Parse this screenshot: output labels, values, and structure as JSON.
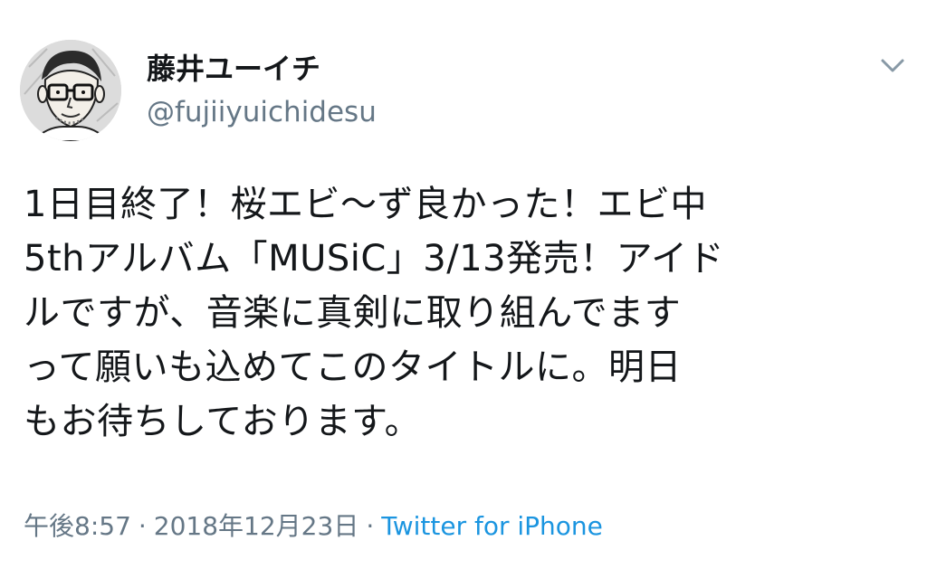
{
  "user": {
    "display_name": "藤井ユーイチ",
    "handle": "@fujiiyuichidesu",
    "avatar_icon": "illustrated-man-glasses-avatar"
  },
  "menu": {
    "icon": "chevron-down-icon"
  },
  "tweet": {
    "lines": [
      "1日目終了！桜エビ〜ず良かった！エビ中",
      "5thアルバム「MUSiC」3/13発売！アイド",
      "ルですが、音楽に真剣に取り組んでます",
      "って願いも込めてこのタイトルに。明日",
      "もお待ちしております。"
    ]
  },
  "meta": {
    "time": "午後8:57",
    "separator": "·",
    "date": "2018年12月23日",
    "source": "Twitter for iPhone"
  },
  "colors": {
    "text": "#14171a",
    "secondary": "#657786",
    "link": "#1b95e0"
  }
}
